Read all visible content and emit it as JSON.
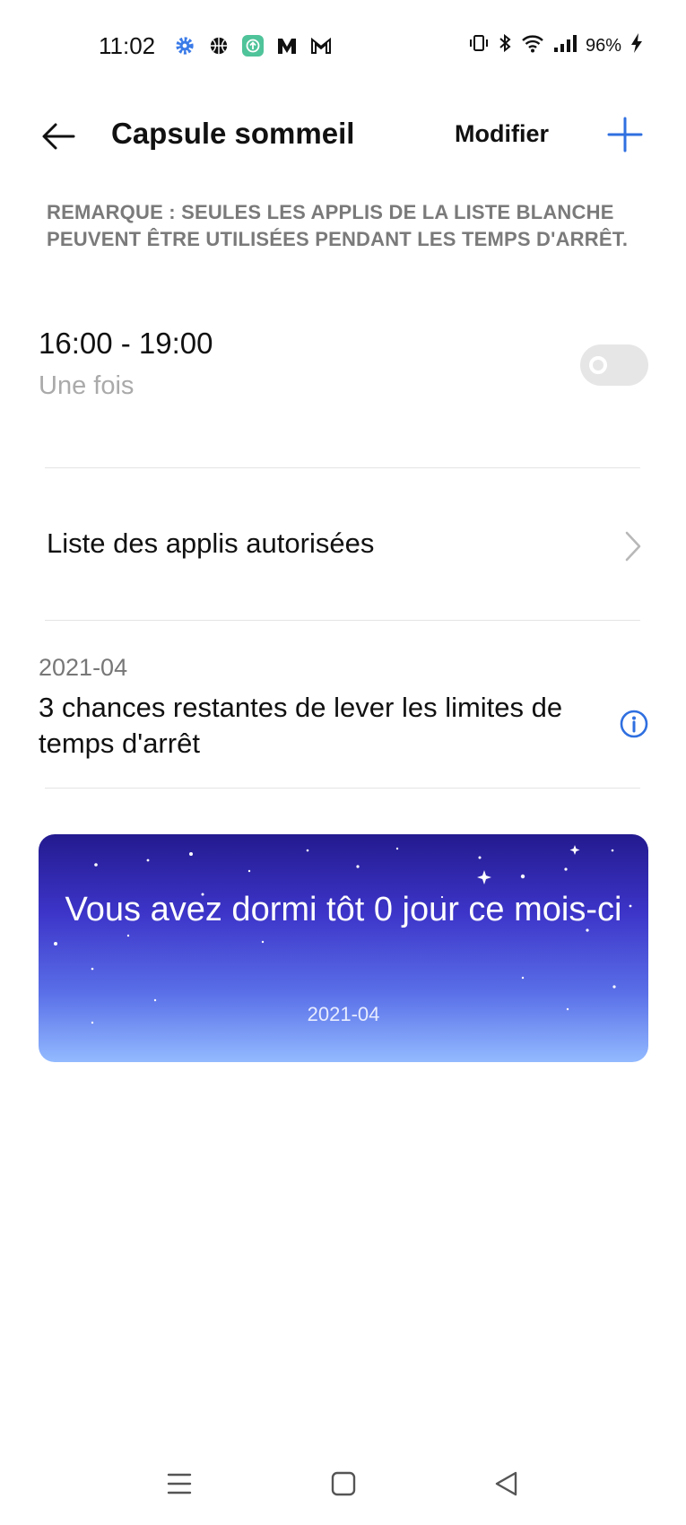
{
  "status_bar": {
    "time": "11:02",
    "battery": "96%",
    "left_icons": [
      "settings-icon",
      "basketball-icon",
      "app-update-icon",
      "m-app-icon",
      "gmail-icon"
    ],
    "right_icons": [
      "vibrate-icon",
      "bluetooth-icon",
      "wifi-icon",
      "signal-icon",
      "charging-icon"
    ]
  },
  "app_bar": {
    "title": "Capsule sommeil",
    "modify_label": "Modifier",
    "add_icon": "plus-icon",
    "back_icon": "back-arrow-icon",
    "accent_color": "#2f6fe0"
  },
  "note": "REMARQUE : SEULES LES APPLIS DE LA LISTE BLANCHE PEUVENT ÊTRE UTILISÉES PENDANT LES TEMPS D'ARRÊT.",
  "schedule": {
    "time_range": "16:00 - 19:00",
    "repeat": "Une fois",
    "enabled": false
  },
  "allowed_apps": {
    "label": "Liste des applis autorisées"
  },
  "chances": {
    "date": "2021-04",
    "text": "3 chances restantes de lever les limites de temps d'arrêt"
  },
  "sleep_card": {
    "message": "Vous avez dormi tôt 0 jour ce mois-ci",
    "date": "2021-04"
  },
  "nav_bar": {
    "icons": [
      "menu-icon",
      "home-icon",
      "back-icon"
    ]
  }
}
